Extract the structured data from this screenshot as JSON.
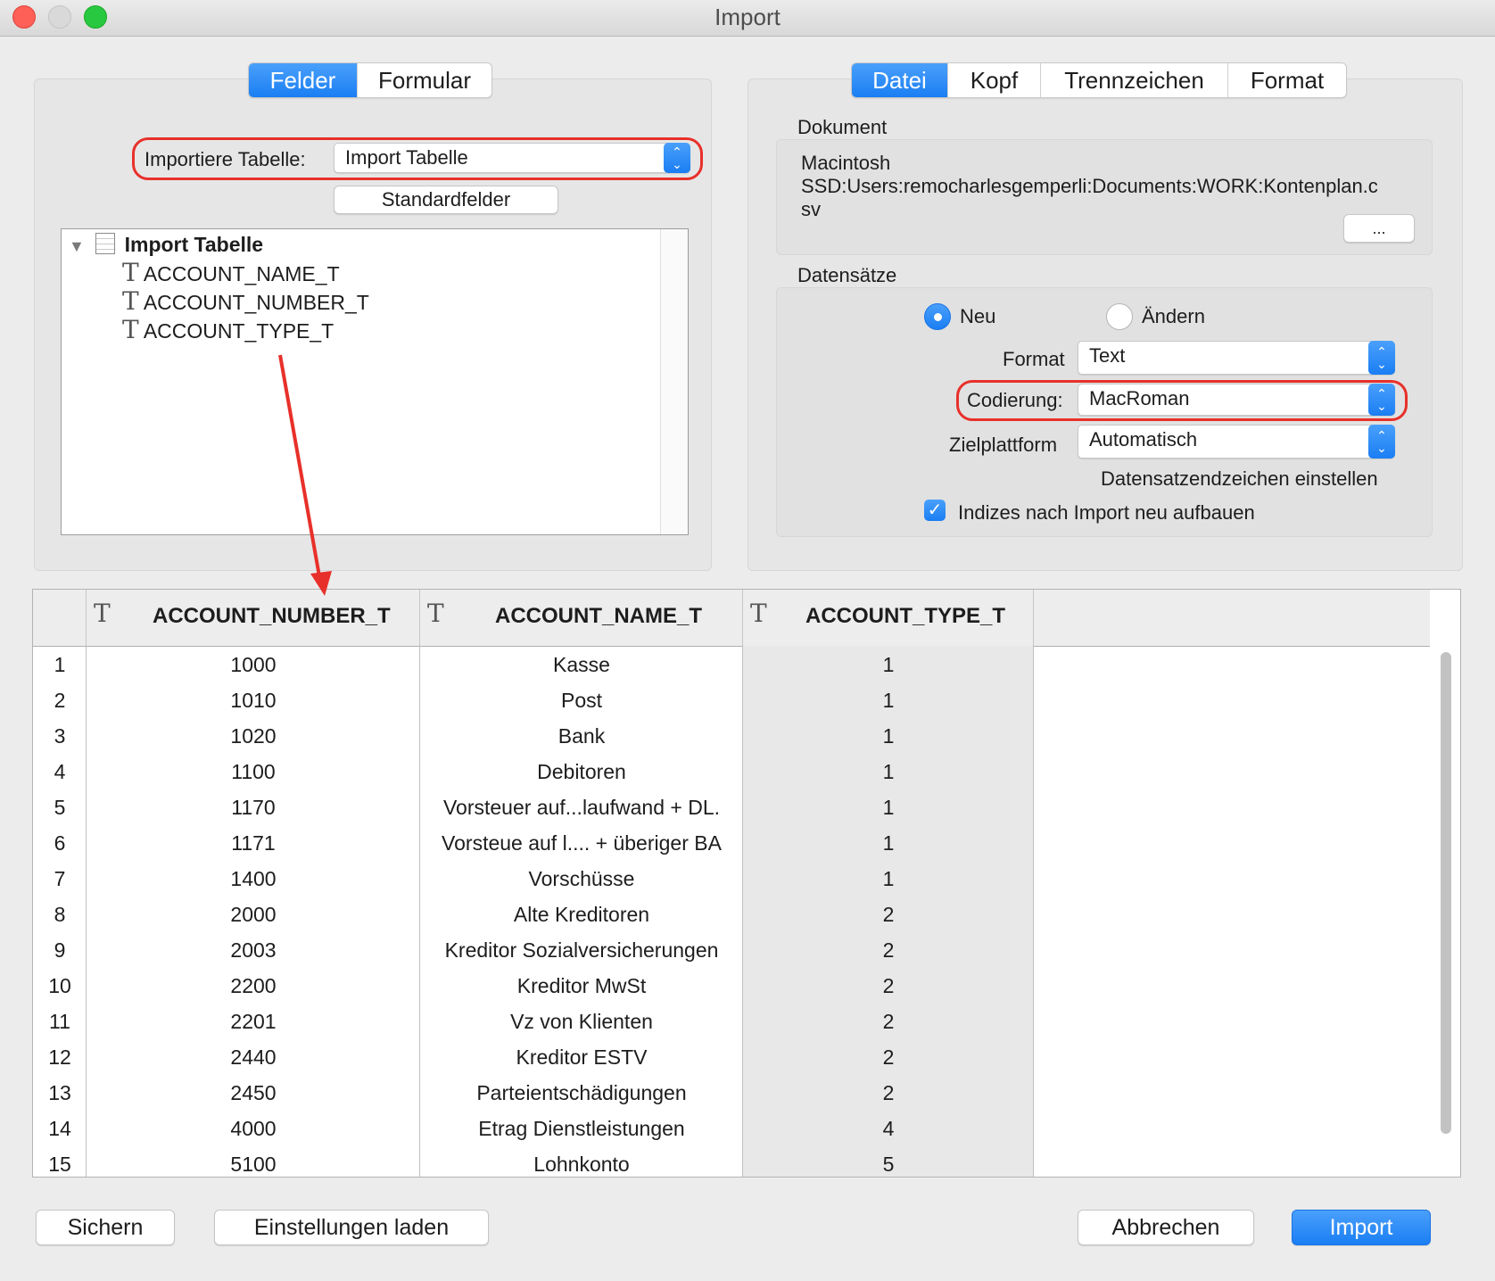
{
  "window": {
    "title": "Import"
  },
  "left_tabs": [
    {
      "label": "Felder",
      "active": true
    },
    {
      "label": "Formular",
      "active": false
    }
  ],
  "import_table": {
    "label": "Importiere Tabelle:",
    "value": "Import Tabelle"
  },
  "standard_fields_button": "Standardfelder",
  "tree": {
    "root": "Import Tabelle",
    "fields": [
      "ACCOUNT_NAME_T",
      "ACCOUNT_NUMBER_T",
      "ACCOUNT_TYPE_T"
    ]
  },
  "right_tabs": [
    {
      "label": "Datei",
      "active": true
    },
    {
      "label": "Kopf",
      "active": false
    },
    {
      "label": "Trennzeichen",
      "active": false
    },
    {
      "label": "Format",
      "active": false
    }
  ],
  "document": {
    "section_label": "Dokument",
    "path_line1": "Macintosh",
    "path_line2": "SSD:Users:remocharlesgemperli:Documents:WORK:Kontenplan.c",
    "path_line3": "sv",
    "browse_button": "..."
  },
  "records": {
    "section_label": "Datensätze",
    "radio_new": "Neu",
    "radio_change": "Ändern",
    "format_label": "Format",
    "format_value": "Text",
    "encoding_label": "Codierung:",
    "encoding_value": "MacRoman",
    "platform_label": "Zielplattform",
    "platform_value": "Automatisch",
    "record_end_link": "Datensatzendzeichen einstellen",
    "rebuild_indexes": "Indizes nach Import neu aufbauen"
  },
  "grid": {
    "columns": [
      "ACCOUNT_NUMBER_T",
      "ACCOUNT_NAME_T",
      "ACCOUNT_TYPE_T"
    ],
    "rows": [
      [
        "1",
        "1000",
        "Kasse",
        "1"
      ],
      [
        "2",
        "1010",
        "Post",
        "1"
      ],
      [
        "3",
        "1020",
        "Bank",
        "1"
      ],
      [
        "4",
        "1100",
        "Debitoren",
        "1"
      ],
      [
        "5",
        "1170",
        "Vorsteuer auf...laufwand + DL.",
        "1"
      ],
      [
        "6",
        "1171",
        "Vorsteue auf l.... + überiger BA",
        "1"
      ],
      [
        "7",
        "1400",
        "Vorschüsse",
        "1"
      ],
      [
        "8",
        "2000",
        "Alte Kreditoren",
        "2"
      ],
      [
        "9",
        "2003",
        "Kreditor Sozialversicherungen",
        "2"
      ],
      [
        "10",
        "2200",
        "Kreditor MwSt",
        "2"
      ],
      [
        "11",
        "2201",
        "Vz von Klienten",
        "2"
      ],
      [
        "12",
        "2440",
        "Kreditor ESTV",
        "2"
      ],
      [
        "13",
        "2450",
        "Parteientschädigungen",
        "2"
      ],
      [
        "14",
        "4000",
        "Etrag Dienstleistungen",
        "4"
      ],
      [
        "15",
        "5100",
        "Lohnkonto",
        "5"
      ]
    ]
  },
  "footer": {
    "save": "Sichern",
    "load": "Einstellungen laden",
    "cancel": "Abbrechen",
    "import": "Import"
  },
  "colors": {
    "accent": "#1a7ef3",
    "annotation_red": "#e8302a"
  },
  "icons": {
    "text_field": "T"
  }
}
